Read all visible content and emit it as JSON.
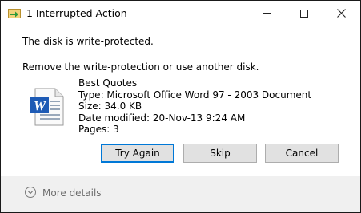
{
  "window": {
    "title": "1 Interrupted Action",
    "controls": {
      "minimize": "minimize-icon",
      "maximize": "maximize-icon",
      "close": "close-icon"
    }
  },
  "message": {
    "line1": "The disk is write-protected.",
    "line2": "Remove the write-protection or use another disk."
  },
  "file": {
    "icon": "word-document-icon",
    "name": "Best Quotes",
    "type": "Type: Microsoft Office Word 97 - 2003 Document",
    "size": "Size: 34.0 KB",
    "modified": "Date modified: 20-Nov-13 9:24 AM",
    "pages": "Pages: 3"
  },
  "buttons": {
    "try_again": "Try Again",
    "skip": "Skip",
    "cancel": "Cancel"
  },
  "footer": {
    "more_details": "More details"
  },
  "colors": {
    "accent": "#0078d7",
    "word_blue": "#1e5bb5",
    "footer_bg": "#f0f0f0"
  }
}
